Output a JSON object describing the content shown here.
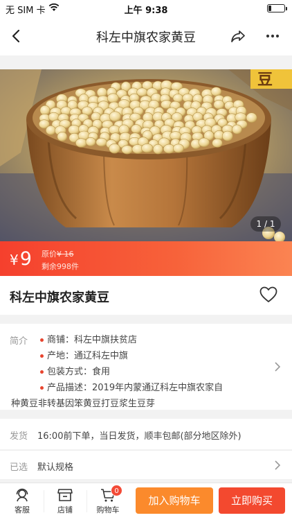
{
  "status_bar": {
    "carrier": "无 SIM 卡",
    "time": "上午 9:38",
    "battery_level": 0.2
  },
  "nav": {
    "title": "科左中旗农家黄豆",
    "icons": [
      "back-arrow-icon",
      "share-icon",
      "more-icon"
    ]
  },
  "gallery": {
    "pager": "1 / 1",
    "image_text": "豆"
  },
  "price": {
    "currency": "¥",
    "value": "9",
    "original_label": "原价",
    "original_price": "¥ 16",
    "stock": "剩余998件",
    "gradient_colors": [
      "#f5402d",
      "#fb8452"
    ]
  },
  "product": {
    "name": "科左中旗农家黄豆"
  },
  "intro": {
    "label": "简介",
    "lines": [
      "商铺：科左中旗扶贫店",
      "产地：通辽科左中旗",
      "包装方式：食用",
      "产品描述：2019年内蒙通辽科左中旗农家自"
    ],
    "continuation": "种黄豆非转基因笨黄豆打豆浆生豆芽"
  },
  "shipping": {
    "label": "发货",
    "value": "16:00前下单，当日发货，顺丰包邮(部分地区除外)"
  },
  "spec": {
    "label": "已选",
    "value": "默认规格"
  },
  "tab_bar": {
    "service": "客服",
    "shop": "店铺",
    "cart": "购物车",
    "cart_count": "0",
    "add_to_cart": "加入购物车",
    "buy_now": "立即购买"
  },
  "colors": {
    "accent_red": "#f3492f",
    "accent_orange": "#fb8a2c",
    "bullet": "#e8452f"
  }
}
